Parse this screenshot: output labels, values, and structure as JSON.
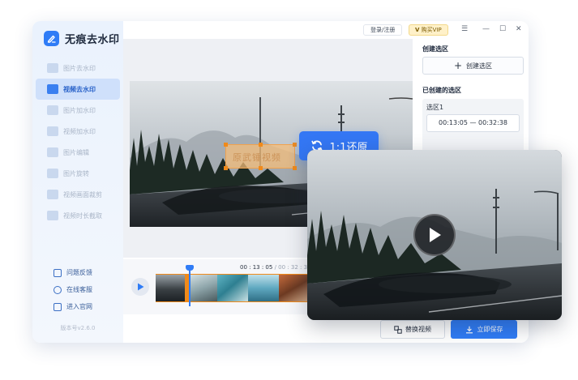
{
  "app": {
    "name": "无痕去水印",
    "version": "版本号v2.6.0"
  },
  "sidebar": {
    "items": [
      {
        "label": "图片去水印",
        "active": false
      },
      {
        "label": "视频去水印",
        "active": true
      },
      {
        "label": "图片加水印",
        "active": false
      },
      {
        "label": "视频加水印",
        "active": false
      },
      {
        "label": "图片编辑",
        "active": false
      },
      {
        "label": "图片旋转",
        "active": false
      },
      {
        "label": "视频画面裁剪",
        "active": false
      },
      {
        "label": "视频时长截取",
        "active": false
      }
    ],
    "links": [
      {
        "label": "问题反馈",
        "icon": "feedback-icon"
      },
      {
        "label": "在线客服",
        "icon": "customer-service-icon"
      },
      {
        "label": "进入官网",
        "icon": "website-icon"
      }
    ]
  },
  "topbar": {
    "login_label": "登录/注册",
    "vip_label": "购买VIP",
    "menu_glyph": "☰",
    "minimize_glyph": "—",
    "maximize_glyph": "☐",
    "close_glyph": "✕"
  },
  "editor": {
    "watermark_text": "原武锤视频"
  },
  "timeline": {
    "current_time": "00 : 13 : 05",
    "separator": " / ",
    "total_time": "00 : 32 : 38"
  },
  "right_panel": {
    "create_title": "创建选区",
    "create_button": "创建选区",
    "created_title": "已创建的选区",
    "selections": [
      {
        "name": "选区1",
        "range": "00:13:05 — 00:32:38"
      }
    ]
  },
  "bottom": {
    "replace_label": "替换视频",
    "save_label": "立即保存"
  },
  "overlay": {
    "restore_label": "1:1还原"
  },
  "colors": {
    "accent": "#2f7cf6",
    "selection": "#f08a1a",
    "vip_bg": "#fff1c9"
  }
}
